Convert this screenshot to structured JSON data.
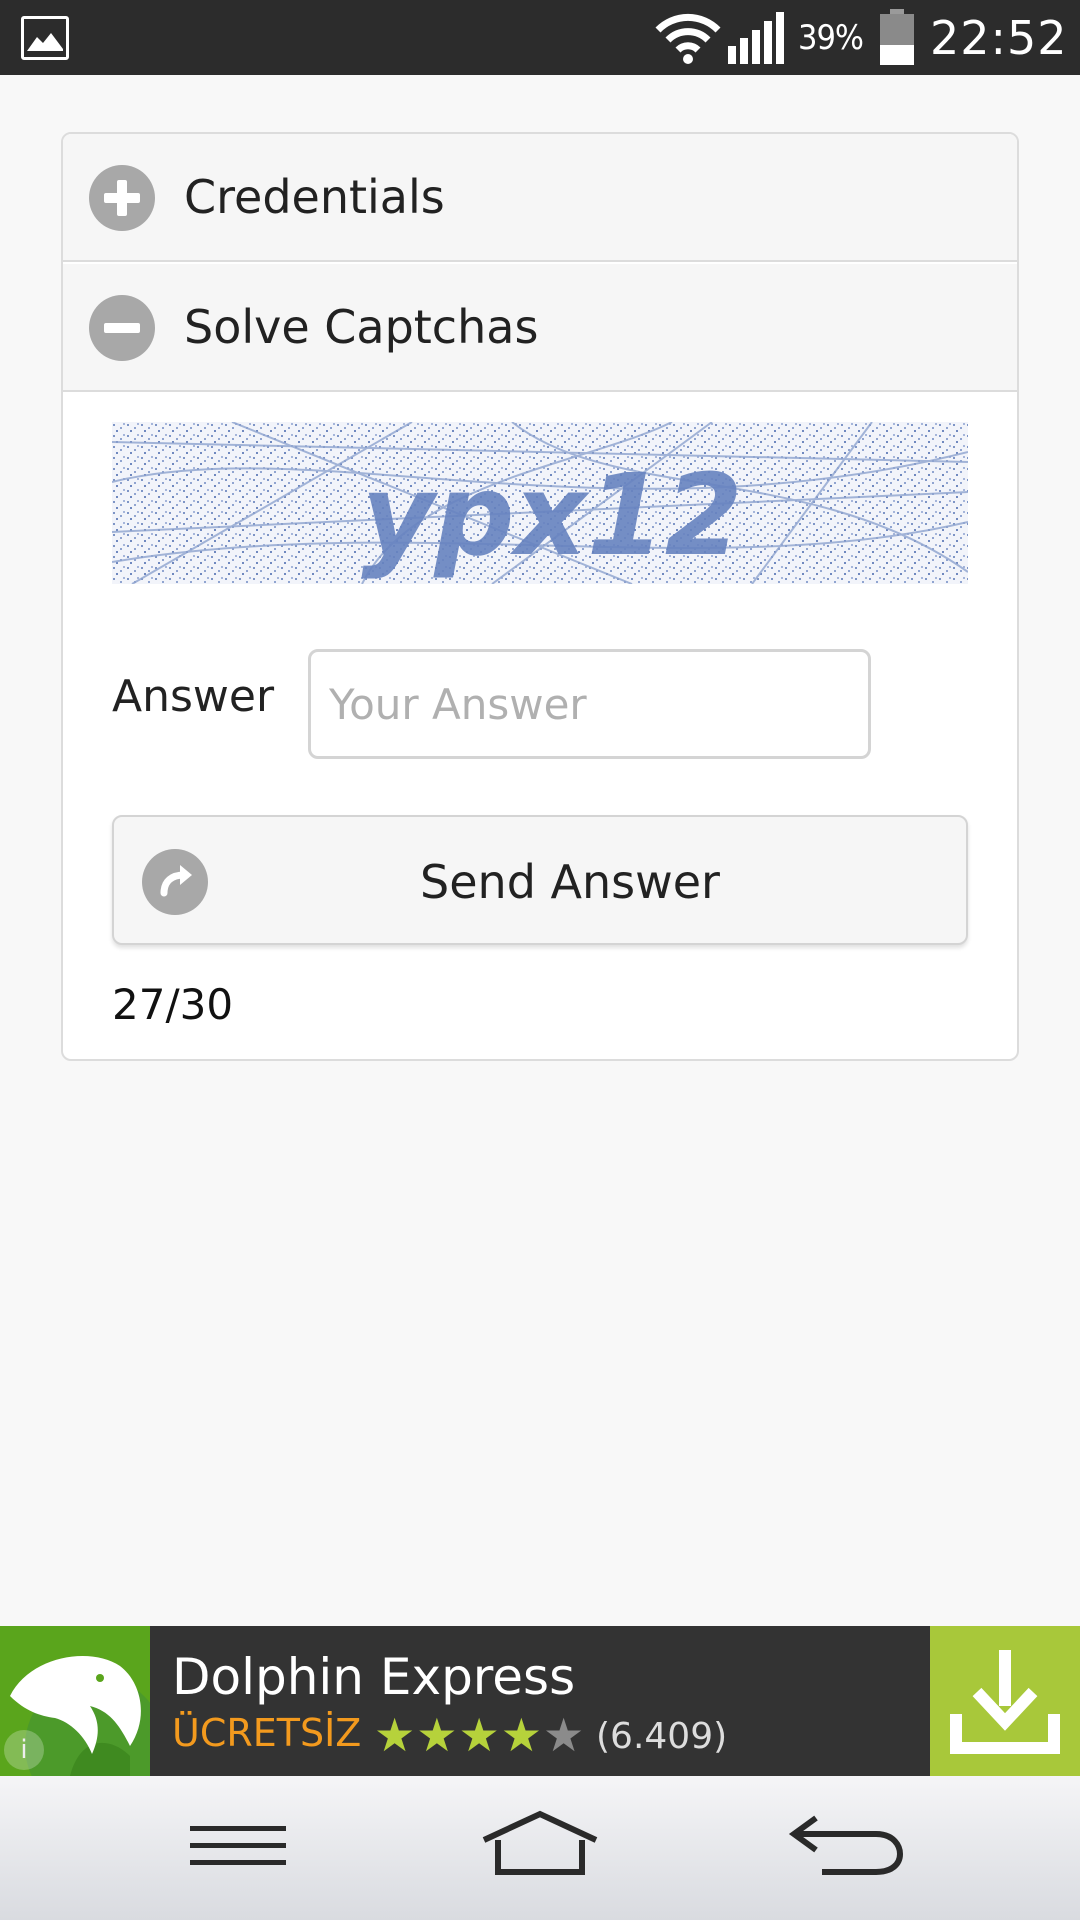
{
  "status_bar": {
    "battery_percent": "39%",
    "battery_level": 0.39,
    "time": "22:52",
    "icons": [
      "gallery-icon",
      "wifi-icon",
      "signal-icon",
      "battery-icon"
    ]
  },
  "accordion": {
    "sections": [
      {
        "title": "Credentials",
        "state": "collapsed",
        "icon": "plus-icon"
      },
      {
        "title": "Solve Captchas",
        "state": "expanded",
        "icon": "minus-icon"
      }
    ]
  },
  "captcha": {
    "answer_label": "Answer",
    "answer_value": "",
    "answer_placeholder": "Your Answer",
    "send_label": "Send Answer",
    "send_icon": "redo-arrow-icon",
    "counter": "27/30"
  },
  "ad": {
    "app_name": "Dolphin Express",
    "price": "ÜCRETSİZ",
    "rating_stars": 4,
    "rating_max": 5,
    "rating_count": "(6.409)",
    "colors": {
      "price": "#f39a1e",
      "star": "#b6d23b",
      "download_bg": "#a8c83a",
      "icon_bg": "#5aa51c"
    }
  },
  "navbar": {
    "buttons": [
      "menu-icon",
      "home-icon",
      "back-icon"
    ]
  },
  "colors": {
    "page_bg": "#f8f8f8",
    "status_bg": "#2c2c2c",
    "accordion_header_bg": "#f6f6f6",
    "icon_gray": "#a8a8a8"
  }
}
